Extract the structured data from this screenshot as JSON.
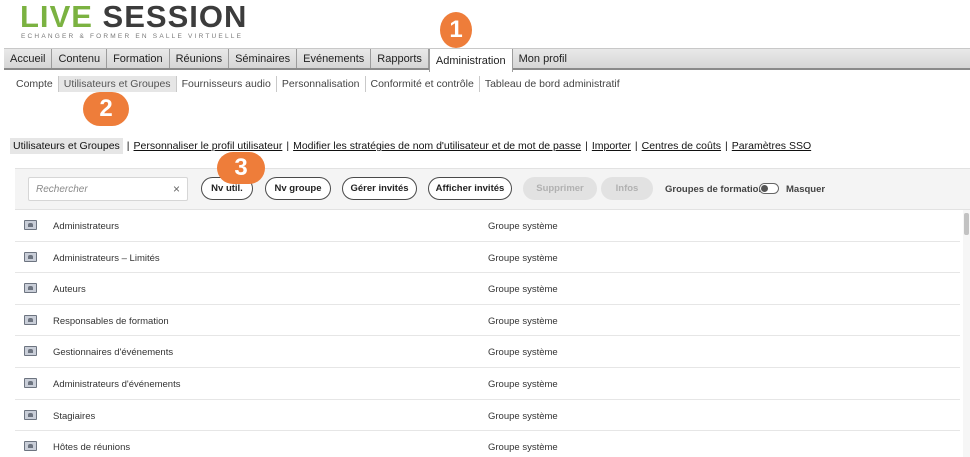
{
  "logo": {
    "part1": "LI",
    "part2": "VE",
    "part3": "SESSION",
    "tagline": "ECHANGER & FORMER EN SALLE VIRTUELLE"
  },
  "topnav": {
    "items": [
      "Accueil",
      "Contenu",
      "Formation",
      "Réunions",
      "Séminaires",
      "Evénements",
      "Rapports",
      "Administration",
      "Mon profil"
    ],
    "active": "Administration"
  },
  "subnav": {
    "items": [
      "Compte",
      "Utilisateurs et Groupes",
      "Fournisseurs audio",
      "Personnalisation",
      "Conformité et contrôle",
      "Tableau de bord administratif"
    ],
    "active": "Utilisateurs et Groupes"
  },
  "badges": [
    "1",
    "2",
    "3"
  ],
  "links": {
    "active": "Utilisateurs et Groupes",
    "separator": "|",
    "items": [
      "Personnaliser le profil utilisateur",
      "Modifier les stratégies de nom d'utilisateur et de mot de passe",
      "Importer",
      "Centres de coûts",
      "Paramètres SSO"
    ]
  },
  "toolbar": {
    "search_placeholder": "Rechercher",
    "clear_icon": "×",
    "buttons": [
      "Nv util.",
      "Nv groupe",
      "Gérer invités",
      "Afficher invités",
      "Supprimer",
      "Infos"
    ],
    "groups_label": "Groupes de formation",
    "hide_label": "Masquer"
  },
  "groups": [
    {
      "name": "Administrateurs",
      "type": "Groupe système"
    },
    {
      "name": "Administrateurs – Limités",
      "type": "Groupe système"
    },
    {
      "name": "Auteurs",
      "type": "Groupe système"
    },
    {
      "name": "Responsables de formation",
      "type": "Groupe système"
    },
    {
      "name": "Gestionnaires d'événements",
      "type": "Groupe système"
    },
    {
      "name": "Administrateurs d'événements",
      "type": "Groupe système"
    },
    {
      "name": "Stagiaires",
      "type": "Groupe système"
    },
    {
      "name": "Hôtes de réunions",
      "type": "Groupe système"
    }
  ],
  "colors": {
    "brand_green": "#7bb241",
    "badge_orange": "#ee7d3a"
  }
}
